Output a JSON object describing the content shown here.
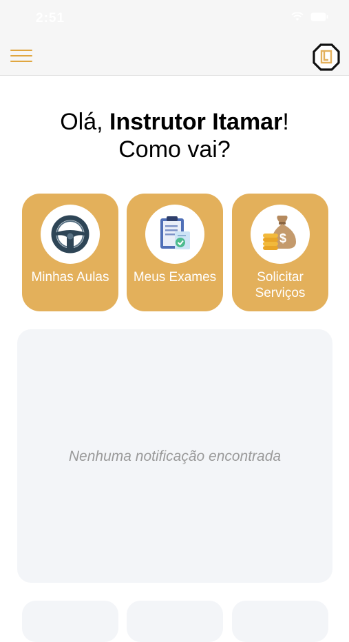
{
  "status_bar": {
    "time": "2:51"
  },
  "navbar": {
    "menu_icon": "hamburger-icon",
    "logo_icon": "app-logo-icon"
  },
  "greeting": {
    "prefix": "Olá, ",
    "name": "Instrutor Itamar",
    "suffix": "!",
    "line2": "Como vai?"
  },
  "tiles": [
    {
      "label": "Minhas Aulas",
      "icon": "steering-wheel-icon"
    },
    {
      "label": "Meus Exames",
      "icon": "exam-document-icon"
    },
    {
      "label_line1": "Solicitar",
      "label_line2": "Serviços",
      "icon": "money-bag-icon"
    }
  ],
  "notifications": {
    "empty_text": "Nenhuma notificação encontrada"
  },
  "colors": {
    "accent": "#e3b05b",
    "menu": "#e0a640",
    "panel": "#f3f5f8"
  }
}
